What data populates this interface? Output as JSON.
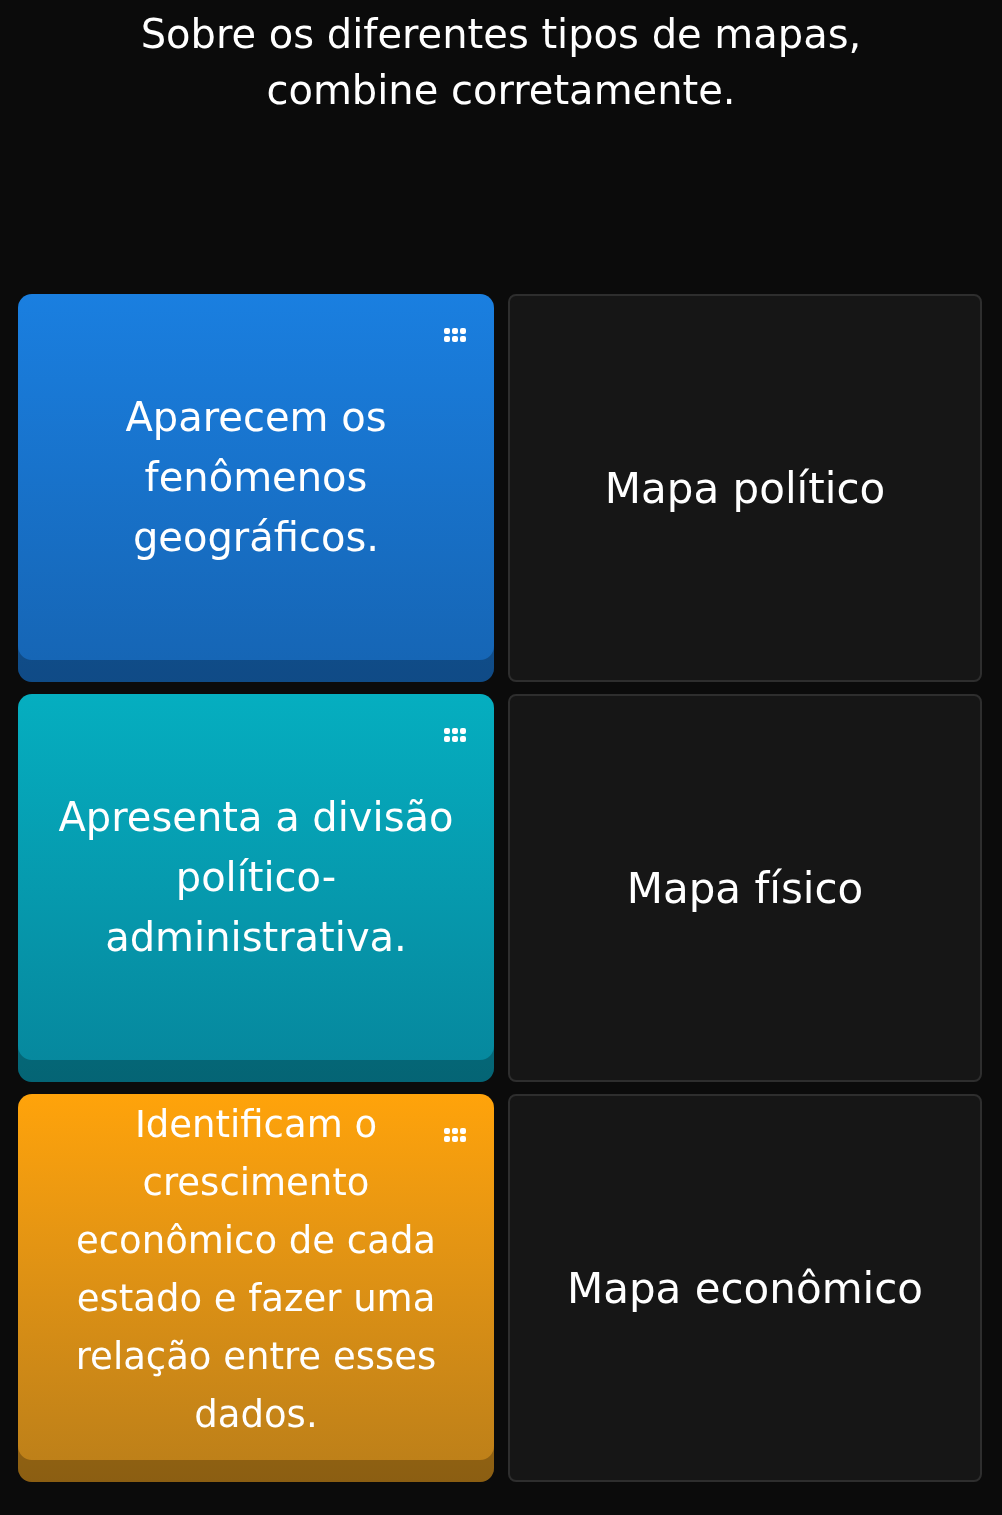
{
  "question": "Sobre os diferentes tipos de mapas, combine corretamente.",
  "pairs": [
    {
      "prompt": "Aparecem os fenômenos geográficos.",
      "color": "#1a7fe0",
      "answer": "Mapa político"
    },
    {
      "prompt": "Apresenta a divisão político-administrativa.",
      "color": "#05aec0",
      "answer": "Mapa físico"
    },
    {
      "prompt": "Identificam o crescimento econômico de cada estado e fazer uma relação entre esses dados.",
      "color": "#ffa30a",
      "answer": "Mapa econômico"
    }
  ]
}
